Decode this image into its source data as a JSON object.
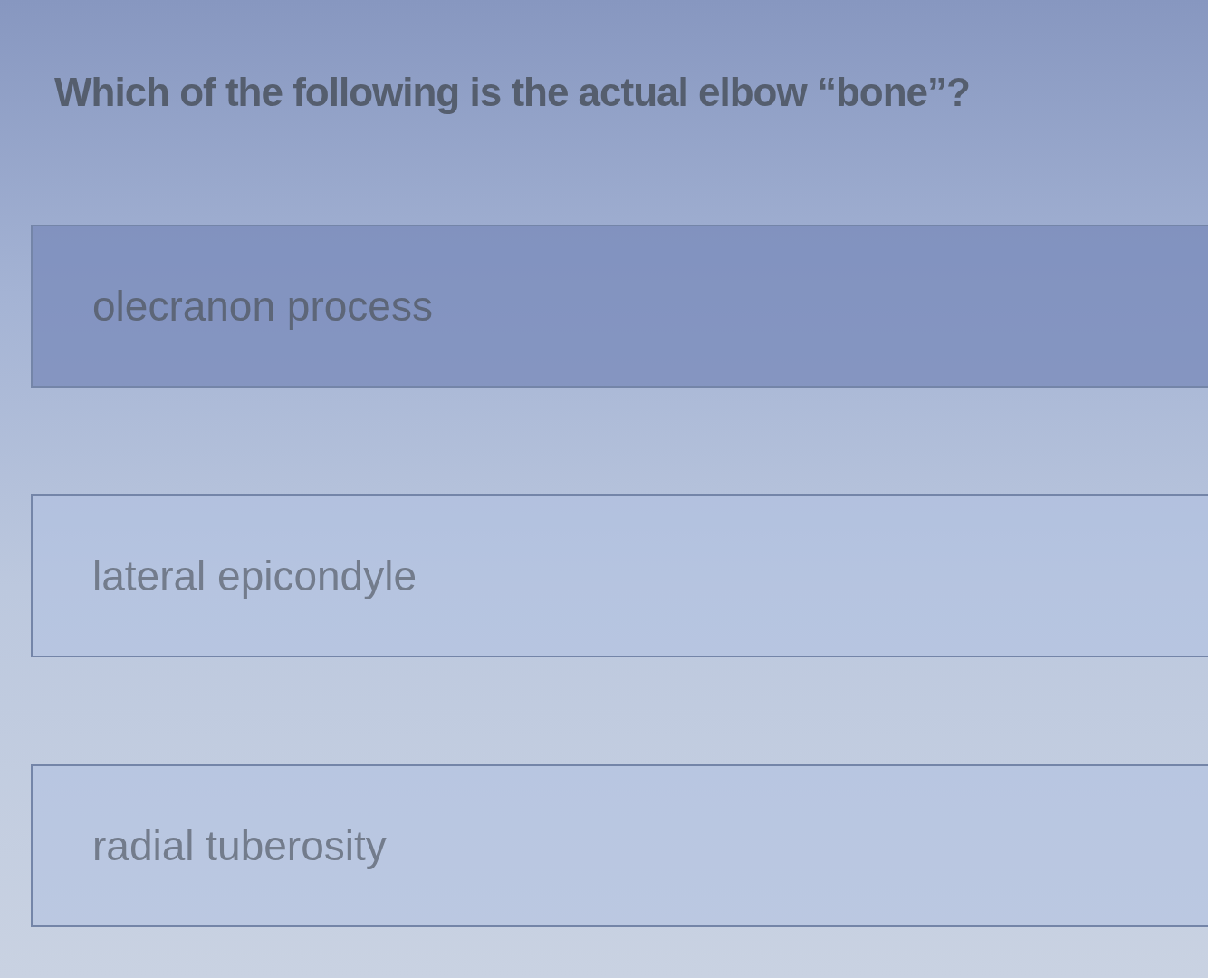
{
  "question": {
    "text": "Which of the following is the actual elbow “bone”?"
  },
  "options": [
    {
      "label": "olecranon process",
      "selected": true
    },
    {
      "label": "lateral epicondyle",
      "selected": false
    },
    {
      "label": "radial tuberosity",
      "selected": false
    }
  ]
}
